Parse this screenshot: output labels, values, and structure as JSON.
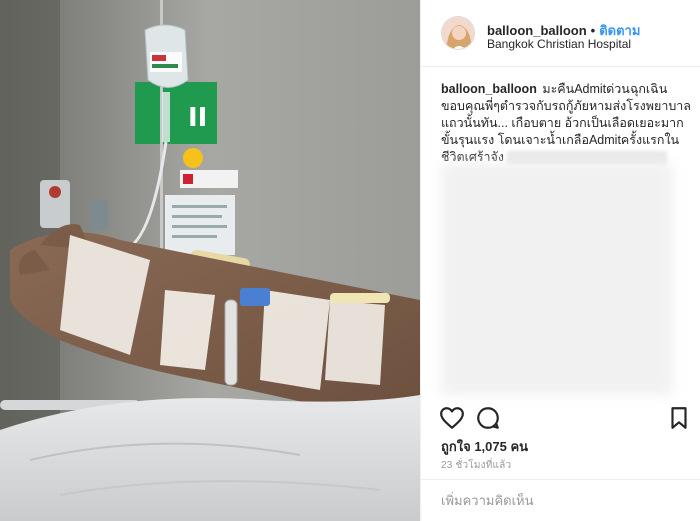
{
  "post": {
    "username": "balloon_balloon",
    "separator": "•",
    "follow_label": "ติดตาม",
    "location": "Bangkok Christian Hospital",
    "caption_text": "มะคืนAdmitด่วนฉุกเฉิน ขอบคุณพี่ๆตำรวจกับรถกู้ภัยหามส่งโรงพยาบาลแถวนั้นทัน... เกือบตาย อ้วกเป็นเลือดเยอะมากขั้นรุนแรง โดนเจาะน้ำเกลือAdmitครั้งแรกในชีวิตเศร้าจัง",
    "likes_label": "ถูกใจ 1,075 คน",
    "timestamp": "23 ชั่วโมงที่แล้ว",
    "comment_placeholder": "เพิ่มความคิดเห็น"
  },
  "icons": {
    "like": "heart-outline-icon",
    "comment": "speech-bubble-icon",
    "save": "bookmark-icon"
  },
  "colors": {
    "follow": "#3897f0",
    "text": "#262626",
    "muted": "#999999",
    "border": "#efefef"
  },
  "photo": {
    "sign_text": "II"
  }
}
